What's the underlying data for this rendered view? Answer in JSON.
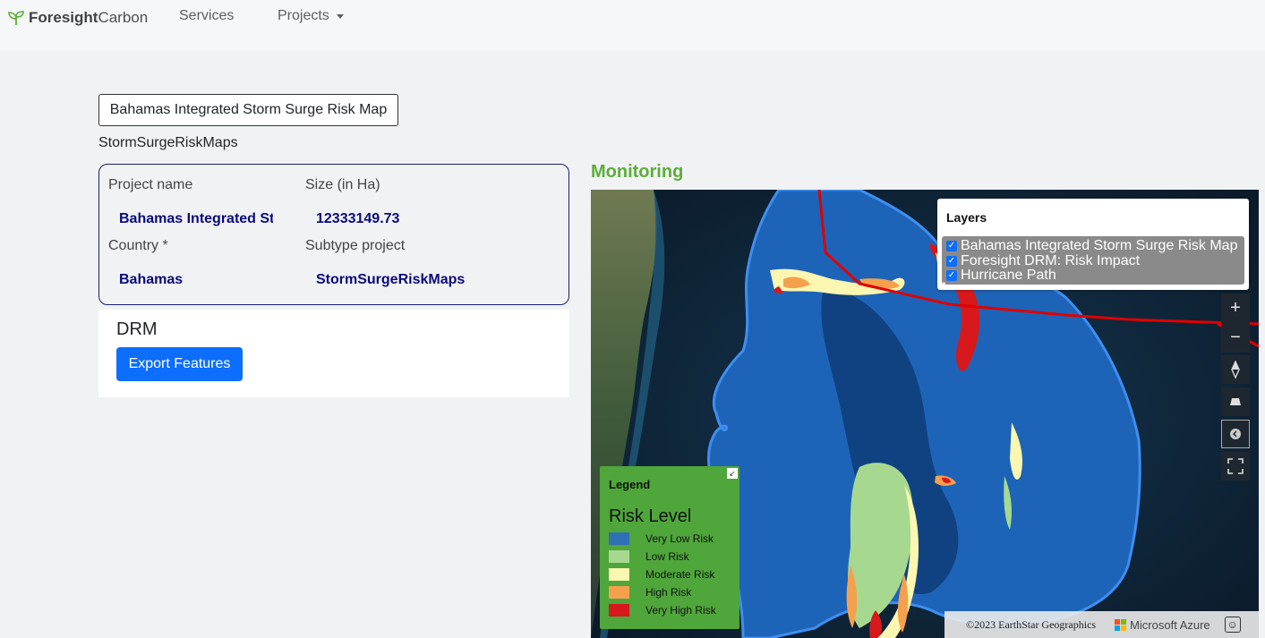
{
  "nav": {
    "brand_bold": "Foresight",
    "brand_light": "Carbon",
    "services": "Services",
    "projects": "Projects"
  },
  "project": {
    "title": "Bahamas Integrated Storm Surge Risk Map",
    "subtype_heading": "StormSurgeRiskMaps",
    "fields": {
      "name_label": "Project name",
      "name_value": "Bahamas Integrated Storm Surge Risk Map",
      "size_label": "Size (in Ha)",
      "size_value": "12333149.73",
      "country_label": "Country *",
      "country_value": "Bahamas",
      "subtype_label": "Subtype project",
      "subtype_value": "StormSurgeRiskMaps"
    }
  },
  "drm": {
    "title": "DRM",
    "export_label": "Export Features"
  },
  "monitoring": {
    "title": "Monitoring"
  },
  "map": {
    "layers_title": "Layers",
    "layers": [
      {
        "label": "Bahamas Integrated Storm Surge Risk Map",
        "checked": true
      },
      {
        "label": "Foresight DRM: Risk Impact",
        "checked": true
      },
      {
        "label": "Hurricane Path",
        "checked": true
      }
    ],
    "controls": [
      "zoom-in-icon",
      "zoom-out-icon",
      "compass-icon",
      "pitch-icon",
      "style-picker-icon",
      "fullscreen-icon"
    ],
    "legend": {
      "heading": "Legend",
      "title": "Risk Level",
      "items": [
        {
          "label": "Very Low Risk",
          "color": "#2f6fb3"
        },
        {
          "label": "Low Risk",
          "color": "#a6d98f"
        },
        {
          "label": "Moderate Risk",
          "color": "#fbf6b0"
        },
        {
          "label": "High Risk",
          "color": "#f5a04c"
        },
        {
          "label": "Very High Risk",
          "color": "#d7191c"
        }
      ]
    },
    "attribution": "©2023 EarthStar Geographics",
    "provider": "Microsoft Azure"
  },
  "colors": {
    "accent": "#0d6efd",
    "monitoring": "#5cae3a",
    "legend_bg": "#4fa63a",
    "hurricane_path": "#e00000"
  }
}
